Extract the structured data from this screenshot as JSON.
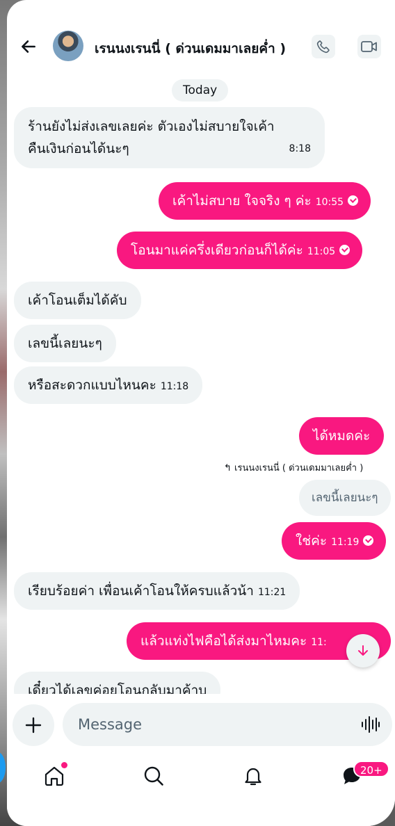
{
  "header": {
    "chat_name": "เรนนงเรนนี่ ( ด่วนเดมมาเลยค่ำ )",
    "icons": [
      "back-arrow-icon",
      "phone-icon",
      "video-icon"
    ]
  },
  "day_separator": "Today",
  "messages": [
    {
      "dir": "in",
      "line1": "ร้านยังไม่ส่งเลขเลยค่ะ ตัวเองไม่สบายใจเค้า",
      "line2": "คืนเงินก่อนได้นะๆ",
      "time": "8:18"
    },
    {
      "dir": "out",
      "text": "เค้าไม่สบาย ใจจริง ๆ ค่ะ",
      "time": "10:55"
    },
    {
      "dir": "out",
      "text": "โอนมาแค่ครึ่งเดียวก่อนก็ได้ค่ะ",
      "time": "11:05"
    },
    {
      "dir": "in",
      "text": "เค้าโอนเต็มได้คับ"
    },
    {
      "dir": "in",
      "text": "เลขนี้เลยนะๆ"
    },
    {
      "dir": "in",
      "text": "หรือสะดวกแบบไหนคะ",
      "time": "11:18"
    },
    {
      "dir": "out",
      "text": "ได้หมดค่ะ"
    },
    {
      "dir": "out",
      "text": "ใช่ค่ะ",
      "time": "11:19"
    },
    {
      "dir": "in",
      "text": "เรียบร้อยค่า เพื่อนเค้าโอนให้ครบแล้วน้า",
      "time": "11:21"
    },
    {
      "dir": "out",
      "text": "แล้วแท่งไฟคือได้ส่งมาไหมคะ",
      "time": "11:"
    },
    {
      "dir": "in",
      "text": "เดี๋ยวได้เลขค่อยโอนกลับมาค้าบ"
    }
  ],
  "reply": {
    "label": "↰ เรนนงเรนนี่ ( ด่วนเดมมาเลยค่ำ )",
    "quoted_text": "เลขนี้เลยนะๆ"
  },
  "composer": {
    "placeholder": "Message",
    "icons": [
      "plus-icon",
      "voice-wave-icon"
    ]
  },
  "bottom_nav": {
    "items": [
      "home-icon",
      "search-icon",
      "notifications-icon",
      "messages-icon"
    ],
    "messages_badge": "20+"
  },
  "colors": {
    "accent": "#f91880",
    "incoming_bubble": "#eff3f4",
    "text": "#0f1419",
    "muted": "#536471"
  }
}
